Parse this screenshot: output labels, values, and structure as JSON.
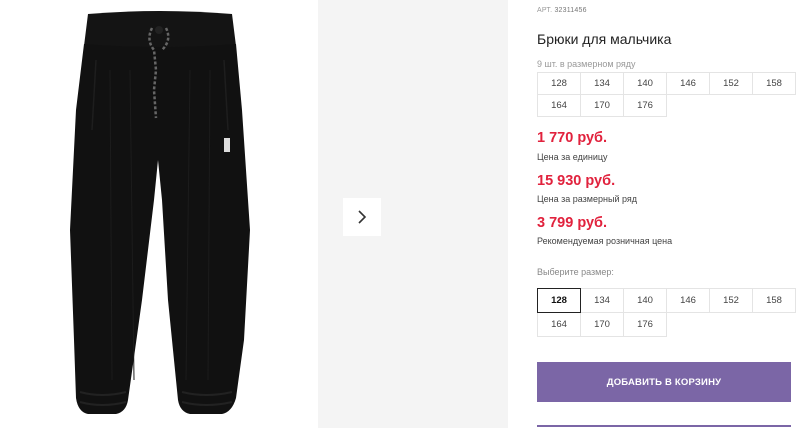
{
  "product": {
    "article_label": "АРТ.",
    "article_number": "32311456",
    "title": "Брюки для мальчика"
  },
  "gallery": {
    "next_icon": "chevron-right-icon"
  },
  "size_row": {
    "note": "9 шт. в размерном ряду",
    "sizes": [
      "128",
      "134",
      "140",
      "146",
      "152",
      "158",
      "164",
      "170",
      "176"
    ]
  },
  "prices": {
    "unit_price": "1 770 руб.",
    "unit_label": "Цена за единицу",
    "row_price": "15 930 руб.",
    "row_label": "Цена за размерный ряд",
    "retail_price": "3 799 руб.",
    "retail_label": "Рекомендуемая розничная цена"
  },
  "size_select": {
    "label": "Выберите размер:",
    "sizes": [
      "128",
      "134",
      "140",
      "146",
      "152",
      "158",
      "164",
      "170",
      "176"
    ],
    "selected": "128"
  },
  "cart": {
    "add_label": "ДОБАВИТЬ В КОРЗИНУ"
  },
  "colors": {
    "price": "#e1223d",
    "accent": "#7b66a6"
  }
}
